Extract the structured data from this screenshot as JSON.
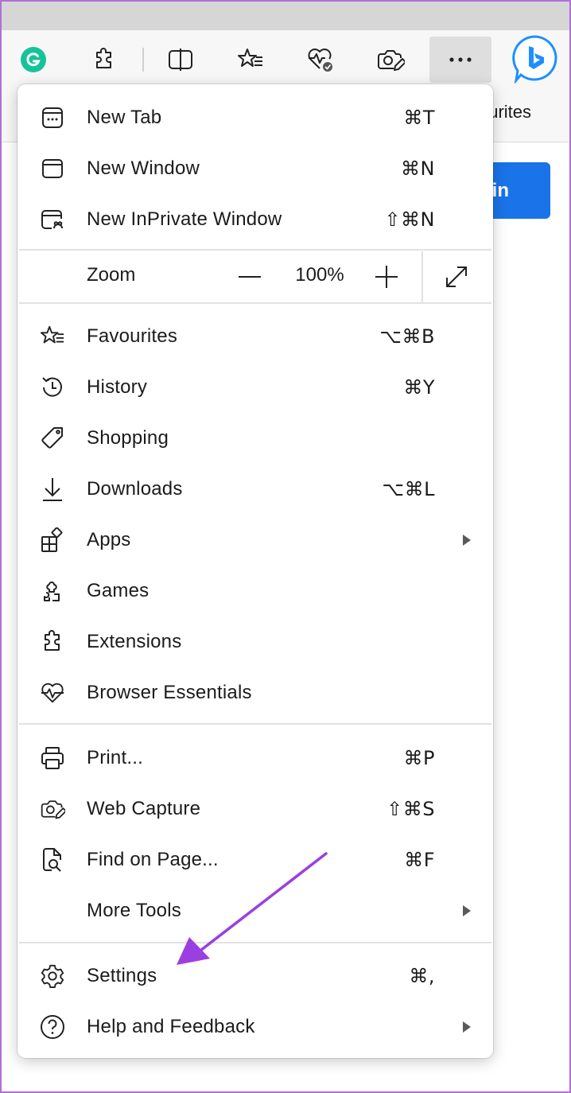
{
  "toolbar": {
    "icons": [
      "grammarly-icon",
      "extensions-icon",
      "split-screen-icon",
      "favourites-icon",
      "browser-essentials-icon",
      "web-capture-icon",
      "more-icon",
      "bing-copilot-icon"
    ],
    "favourites_partial": "ourites",
    "signin_partial": "in"
  },
  "menu": {
    "new_tab": {
      "label": "New Tab",
      "shortcut": "⌘T"
    },
    "new_window": {
      "label": "New Window",
      "shortcut": "⌘N"
    },
    "new_inprivate": {
      "label": "New InPrivate Window",
      "shortcut": "⇧⌘N"
    },
    "zoom": {
      "label": "Zoom",
      "value": "100%"
    },
    "favourites": {
      "label": "Favourites",
      "shortcut": "⌥⌘B"
    },
    "history": {
      "label": "History",
      "shortcut": "⌘Y"
    },
    "shopping": {
      "label": "Shopping",
      "shortcut": ""
    },
    "downloads": {
      "label": "Downloads",
      "shortcut": "⌥⌘L"
    },
    "apps": {
      "label": "Apps",
      "shortcut": ""
    },
    "games": {
      "label": "Games",
      "shortcut": ""
    },
    "extensions": {
      "label": "Extensions",
      "shortcut": ""
    },
    "browser_essentials": {
      "label": "Browser Essentials",
      "shortcut": ""
    },
    "print": {
      "label": "Print...",
      "shortcut": "⌘P"
    },
    "web_capture": {
      "label": "Web Capture",
      "shortcut": "⇧⌘S"
    },
    "find_on_page": {
      "label": "Find on Page...",
      "shortcut": "⌘F"
    },
    "more_tools": {
      "label": "More Tools",
      "shortcut": ""
    },
    "settings": {
      "label": "Settings",
      "shortcut": "⌘,"
    },
    "help_feedback": {
      "label": "Help and Feedback",
      "shortcut": ""
    }
  },
  "colors": {
    "annotation_arrow": "#9b3fe0",
    "frame_border": "#b06fd6",
    "signin_button": "#1a73e8",
    "grammarly": "#15c39a",
    "bing": "#1e8fff"
  }
}
